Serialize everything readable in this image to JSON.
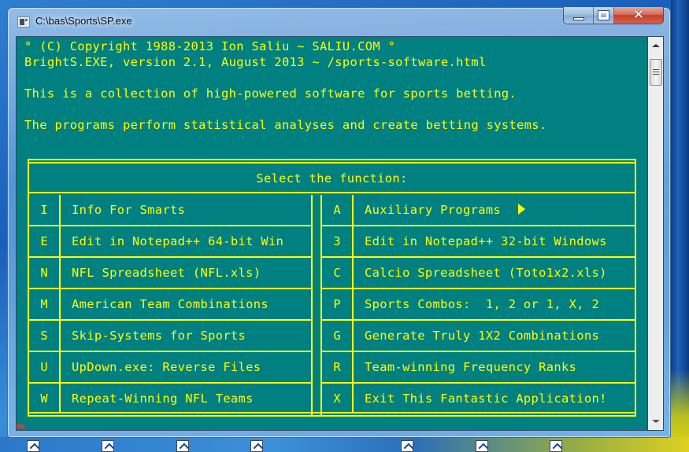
{
  "window": {
    "title": "C:\\bas\\Sports\\SP.exe",
    "controls": {
      "minimize": "minimize",
      "maximize": "maximize",
      "close": "✕"
    }
  },
  "console": {
    "lines": [
      "° (C) Copyright 1988-2013 Ion Saliu ~ SALIU.COM °",
      "BrightS.EXE, version 2.1, August 2013 ~ /sports-software.html",
      "This is a collection of high-powered software for sports betting.",
      "The programs perform statistical analyses and create betting systems."
    ],
    "text_color": "#ffff00",
    "background_color": "#008080"
  },
  "menu": {
    "header": "Select the function:",
    "left": [
      {
        "key": "I",
        "label": "Info For Smarts"
      },
      {
        "key": "E",
        "label": "Edit in Notepad++ 64-bit Win"
      },
      {
        "key": "N",
        "label": "NFL Spreadsheet (NFL.xls)"
      },
      {
        "key": "M",
        "label": "American Team Combinations"
      },
      {
        "key": "S",
        "label": "Skip-Systems for Sports"
      },
      {
        "key": "U",
        "label": "UpDown.exe: Reverse Files"
      },
      {
        "key": "W",
        "label": "Repeat-Winning NFL Teams"
      }
    ],
    "right": [
      {
        "key": "A",
        "label": "Auxiliary Programs",
        "submenu": true
      },
      {
        "key": "3",
        "label": "Edit in Notepad++ 32-bit Windows"
      },
      {
        "key": "C",
        "label": "Calcio Spreadsheet (Toto1x2.xls)"
      },
      {
        "key": "P",
        "label": "Sports Combos:  1, 2 or 1, X, 2"
      },
      {
        "key": "G",
        "label": "Generate Truly 1X2 Combinations"
      },
      {
        "key": "R",
        "label": "Team-winning Frequency Ranks"
      },
      {
        "key": "X",
        "label": "Exit This Fantastic Application!"
      }
    ]
  }
}
